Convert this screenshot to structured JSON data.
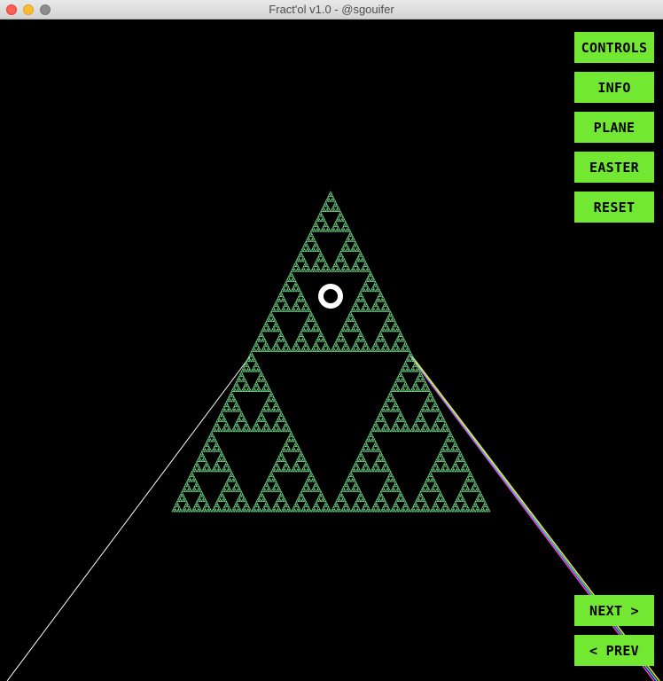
{
  "window": {
    "title": "Fract'ol v1.0 - @sgouifer",
    "colors": {
      "background": "#000000",
      "button": "#72e832",
      "fractal": "#72d687",
      "cursor": "#ffffff"
    }
  },
  "menu": {
    "controls": "CONTROLS",
    "info": "INFO",
    "plane": "PLANE",
    "easter": "EASTER",
    "reset": "RESET"
  },
  "nav": {
    "next": "NEXT >",
    "prev": "< PREV"
  },
  "fractal": {
    "name": "sierpinski-triangle"
  }
}
